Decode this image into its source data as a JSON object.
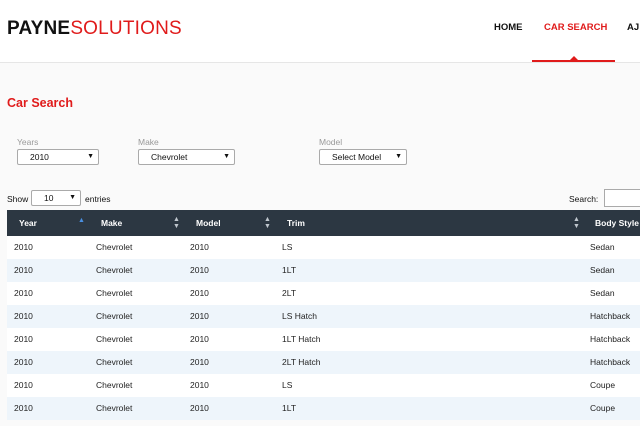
{
  "brand": {
    "part1": "PAYNE",
    "part2": "SOLUTIONS"
  },
  "nav": {
    "home": "HOME",
    "car_search": "CAR SEARCH",
    "partial": "AJ"
  },
  "page_title": "Car Search",
  "filters": {
    "years": {
      "label": "Years",
      "value": "2010"
    },
    "make": {
      "label": "Make",
      "value": "Chevrolet"
    },
    "model": {
      "label": "Model",
      "value": "Select Model"
    }
  },
  "length": {
    "show": "Show",
    "value": "10",
    "entries": "entries"
  },
  "search": {
    "label": "Search:"
  },
  "table": {
    "columns": [
      "Year",
      "Make",
      "Model",
      "Trim",
      "Body Style"
    ],
    "rows": [
      [
        "2010",
        "Chevrolet",
        "2010",
        "LS",
        "Sedan"
      ],
      [
        "2010",
        "Chevrolet",
        "2010",
        "1LT",
        "Sedan"
      ],
      [
        "2010",
        "Chevrolet",
        "2010",
        "2LT",
        "Sedan"
      ],
      [
        "2010",
        "Chevrolet",
        "2010",
        "LS Hatch",
        "Hatchback"
      ],
      [
        "2010",
        "Chevrolet",
        "2010",
        "1LT Hatch",
        "Hatchback"
      ],
      [
        "2010",
        "Chevrolet",
        "2010",
        "2LT Hatch",
        "Hatchback"
      ],
      [
        "2010",
        "Chevrolet",
        "2010",
        "LS",
        "Coupe"
      ],
      [
        "2010",
        "Chevrolet",
        "2010",
        "1LT",
        "Coupe"
      ]
    ]
  },
  "icons": {
    "sort_asc": "sort-asc-icon",
    "sort_both": "sort-both-icon",
    "dropdown": "chevron-down-icon"
  },
  "colors": {
    "brand_red": "#e01b1b",
    "header_dark": "#2c3742",
    "row_alt": "#eef5fb"
  }
}
